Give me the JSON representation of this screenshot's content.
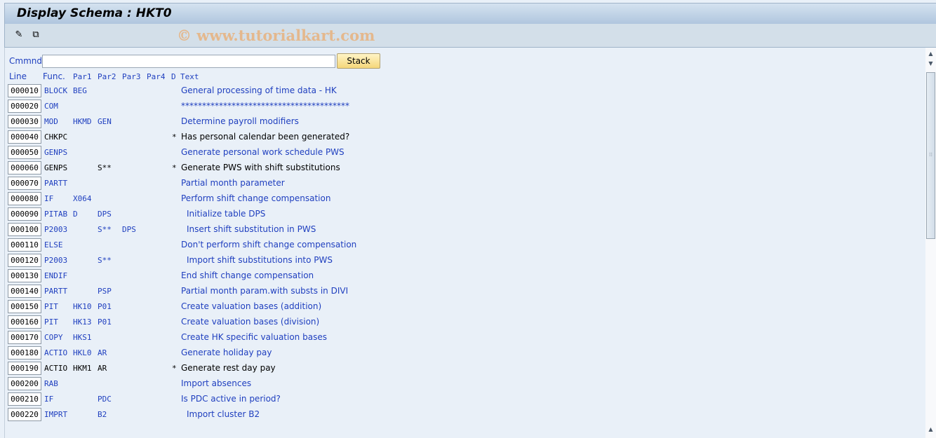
{
  "window": {
    "title": "Display Schema : HKT0"
  },
  "toolbar": {
    "icons": [
      "display-change-icon",
      "other-object-icon"
    ],
    "watermark": "© www.tutorialkart.com"
  },
  "command": {
    "label": "Cmmnd",
    "value": "",
    "stack_label": "Stack"
  },
  "columns": {
    "line": "Line",
    "func": "Func.",
    "par1": "Par1",
    "par2": "Par2",
    "par3": "Par3",
    "par4": "Par4",
    "d": "D",
    "text": "Text"
  },
  "rows": [
    {
      "line": "000010",
      "func": "BLOCK",
      "par1": "BEG",
      "par2": "",
      "par3": "",
      "par4": "",
      "d": "",
      "text": "General processing of time data - HK",
      "indent": false,
      "commented": false
    },
    {
      "line": "000020",
      "func": "COM",
      "par1": "",
      "par2": "",
      "par3": "",
      "par4": "",
      "d": "",
      "text": "****************************************",
      "indent": false,
      "commented": false
    },
    {
      "line": "000030",
      "func": "MOD",
      "par1": "HKMD",
      "par2": "GEN",
      "par3": "",
      "par4": "",
      "d": "",
      "text": "Determine payroll modifiers",
      "indent": false,
      "commented": false
    },
    {
      "line": "000040",
      "func": "CHKPC",
      "par1": "",
      "par2": "",
      "par3": "",
      "par4": "",
      "d": "*",
      "text": "Has personal calendar been generated?",
      "indent": false,
      "commented": true
    },
    {
      "line": "000050",
      "func": "GENPS",
      "par1": "",
      "par2": "",
      "par3": "",
      "par4": "",
      "d": "",
      "text": "Generate personal work schedule PWS",
      "indent": false,
      "commented": false
    },
    {
      "line": "000060",
      "func": "GENPS",
      "par1": "",
      "par2": "S**",
      "par3": "",
      "par4": "",
      "d": "*",
      "text": "Generate PWS with shift substitutions",
      "indent": false,
      "commented": true
    },
    {
      "line": "000070",
      "func": "PARTT",
      "par1": "",
      "par2": "",
      "par3": "",
      "par4": "",
      "d": "",
      "text": "Partial month parameter",
      "indent": false,
      "commented": false
    },
    {
      "line": "000080",
      "func": "IF",
      "par1": "X064",
      "par2": "",
      "par3": "",
      "par4": "",
      "d": "",
      "text": "Perform shift change compensation",
      "indent": false,
      "commented": false
    },
    {
      "line": "000090",
      "func": "PITAB",
      "par1": "D",
      "par2": "DPS",
      "par3": "",
      "par4": "",
      "d": "",
      "text": "Initialize table DPS",
      "indent": true,
      "commented": false
    },
    {
      "line": "000100",
      "func": "P2003",
      "par1": "",
      "par2": "S**",
      "par3": "DPS",
      "par4": "",
      "d": "",
      "text": "Insert shift substitution in PWS",
      "indent": true,
      "commented": false
    },
    {
      "line": "000110",
      "func": "ELSE",
      "par1": "",
      "par2": "",
      "par3": "",
      "par4": "",
      "d": "",
      "text": "Don't perform shift change compensation",
      "indent": false,
      "commented": false
    },
    {
      "line": "000120",
      "func": "P2003",
      "par1": "",
      "par2": "S**",
      "par3": "",
      "par4": "",
      "d": "",
      "text": "Import shift substitutions into PWS",
      "indent": true,
      "commented": false
    },
    {
      "line": "000130",
      "func": "ENDIF",
      "par1": "",
      "par2": "",
      "par3": "",
      "par4": "",
      "d": "",
      "text": "End shift change compensation",
      "indent": false,
      "commented": false
    },
    {
      "line": "000140",
      "func": "PARTT",
      "par1": "",
      "par2": "PSP",
      "par3": "",
      "par4": "",
      "d": "",
      "text": "Partial month param.with substs in DIVI",
      "indent": false,
      "commented": false
    },
    {
      "line": "000150",
      "func": "PIT",
      "par1": "HK10",
      "par2": "P01",
      "par3": "",
      "par4": "",
      "d": "",
      "text": "Create valuation bases (addition)",
      "indent": false,
      "commented": false
    },
    {
      "line": "000160",
      "func": "PIT",
      "par1": "HK13",
      "par2": "P01",
      "par3": "",
      "par4": "",
      "d": "",
      "text": "Create valuation bases (division)",
      "indent": false,
      "commented": false
    },
    {
      "line": "000170",
      "func": "COPY",
      "par1": "HKS1",
      "par2": "",
      "par3": "",
      "par4": "",
      "d": "",
      "text": "Create HK specific valuation bases",
      "indent": false,
      "commented": false
    },
    {
      "line": "000180",
      "func": "ACTIO",
      "par1": "HKL0",
      "par2": "AR",
      "par3": "",
      "par4": "",
      "d": "",
      "text": "Generate holiday pay",
      "indent": false,
      "commented": false
    },
    {
      "line": "000190",
      "func": "ACTIO",
      "par1": "HKM1",
      "par2": "AR",
      "par3": "",
      "par4": "",
      "d": "*",
      "text": "Generate rest day pay",
      "indent": false,
      "commented": true
    },
    {
      "line": "000200",
      "func": "RAB",
      "par1": "",
      "par2": "",
      "par3": "",
      "par4": "",
      "d": "",
      "text": "Import absences",
      "indent": false,
      "commented": false
    },
    {
      "line": "000210",
      "func": "IF",
      "par1": "",
      "par2": "PDC",
      "par3": "",
      "par4": "",
      "d": "",
      "text": "Is PDC active in period?",
      "indent": false,
      "commented": false
    },
    {
      "line": "000220",
      "func": "IMPRT",
      "par1": "",
      "par2": "B2",
      "par3": "",
      "par4": "",
      "d": "",
      "text": "Import cluster B2",
      "indent": true,
      "commented": false
    }
  ],
  "colors": {
    "active": "#1f3fbf",
    "commented": "#000000",
    "stack_button": "#f5d77a"
  }
}
